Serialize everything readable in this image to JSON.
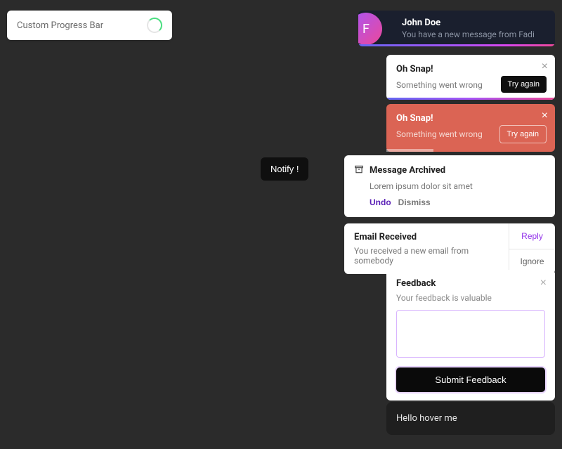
{
  "progress": {
    "label": "Custom Progress Bar"
  },
  "notify": {
    "label": "Notify !"
  },
  "message": {
    "avatar_letter": "F",
    "title": "John Doe",
    "subtitle": "You have a new message from Fadi"
  },
  "snap_white": {
    "title": "Oh Snap!",
    "subtitle": "Something went wrong",
    "button": "Try again"
  },
  "snap_red": {
    "title": "Oh Snap!",
    "subtitle": "Something went wrong",
    "button": "Try again"
  },
  "archived": {
    "title": "Message Archived",
    "subtitle": "Lorem ipsum dolor sit amet",
    "undo": "Undo",
    "dismiss": "Dismiss"
  },
  "email": {
    "title": "Email Received",
    "subtitle": "You received a new email from somebody",
    "reply": "Reply",
    "ignore": "Ignore"
  },
  "feedback": {
    "title": "Feedback",
    "subtitle": "Your feedback is valuable",
    "submit": "Submit Feedback"
  },
  "hover": {
    "text": "Hello hover me"
  }
}
